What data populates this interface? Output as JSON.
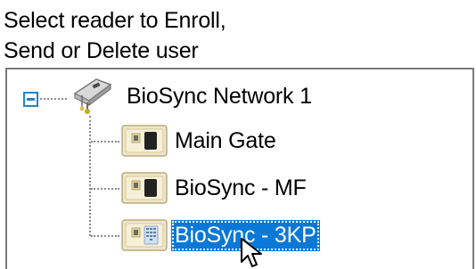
{
  "instructions": {
    "line1": "Select reader to Enroll,",
    "line2": "Send or Delete user"
  },
  "tree": {
    "root": {
      "label": "BioSync Network 1",
      "icon": "network-reader-icon",
      "expanded": true
    },
    "children": [
      {
        "label": "Main Gate",
        "icon": "fingerprint-reader-icon",
        "selected": false
      },
      {
        "label": "BioSync - MF",
        "icon": "fingerprint-reader-icon",
        "selected": false
      },
      {
        "label": "BioSync - 3KP",
        "icon": "keypad-reader-icon",
        "selected": true
      }
    ]
  },
  "colors": {
    "selection": "#0a78d7",
    "expander": "#1a86d8"
  }
}
